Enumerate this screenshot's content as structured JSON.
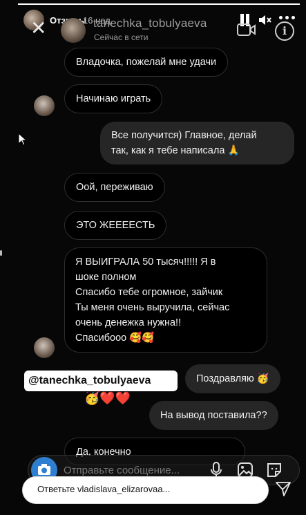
{
  "story": {
    "title": "Отзывы",
    "time": "16 нед.",
    "progress_fraction": 1.0
  },
  "chat": {
    "username": "tanechka_tobulyaeva",
    "status": "Сейчас в сети"
  },
  "messages": [
    {
      "side": "in",
      "text": "Владочка, пожелай мне удачи"
    },
    {
      "side": "in",
      "text": "Начинаю играть"
    },
    {
      "side": "out",
      "lines": [
        "Все получится) Главное, делай",
        "так, как я тебе написала 🙏"
      ]
    },
    {
      "side": "in",
      "text": "Оой, переживаю"
    },
    {
      "side": "in",
      "text": "ЭТО ЖЕЕЕЕСТЬ"
    },
    {
      "side": "in",
      "lines": [
        "Я ВЫИГРАЛА 50 тысяч!!!!! Я в",
        "шоке полном",
        "Спасибо тебе огромное, зайчик",
        "Ты меня очень выручила, сейчас",
        "очень денежка нужна!!",
        "Спасибооо 🥰🥰"
      ]
    },
    {
      "side": "out",
      "text": "Поздравляю 🥳"
    },
    {
      "side": "out",
      "text": "На вывод поставила??"
    },
    {
      "side": "in",
      "text": "Да, конечно"
    }
  ],
  "mention": {
    "text": "@tanechka_tobulyaeva",
    "emoji": "🥳❤️❤️"
  },
  "composer": {
    "placeholder": "Отправьте сообщение..."
  },
  "reply": {
    "placeholder": "Ответьте vladislava_elizarovaa..."
  },
  "colors": {
    "background": "#070707",
    "incoming_border": "#2f2f2f",
    "outgoing_bg": "#262626",
    "camera_button": "#2f7fd1"
  }
}
